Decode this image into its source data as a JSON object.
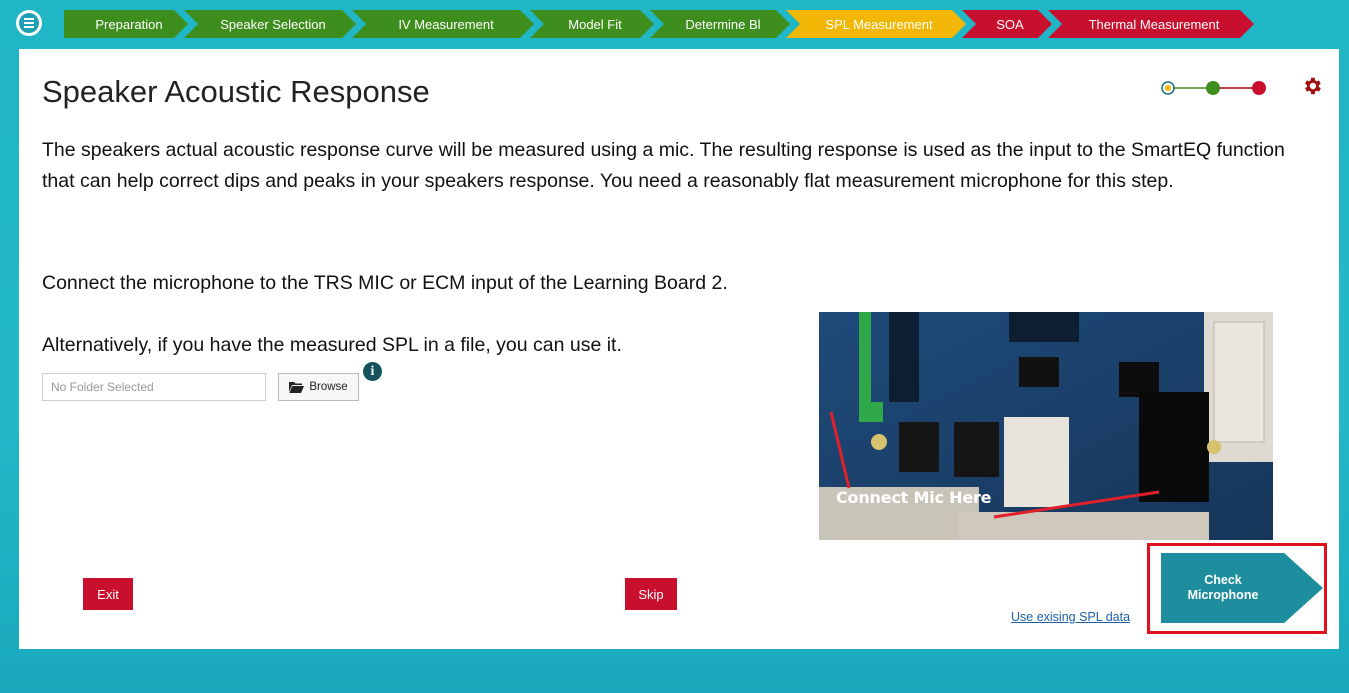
{
  "nav": {
    "steps": [
      {
        "label": "Preparation",
        "color": "#3e8e1e"
      },
      {
        "label": "Speaker Selection",
        "color": "#3e8e1e"
      },
      {
        "label": "IV Measurement",
        "color": "#3e8e1e"
      },
      {
        "label": "Model Fit",
        "color": "#3e8e1e"
      },
      {
        "label": "Determine Bl",
        "color": "#3e8e1e"
      },
      {
        "label": "SPL Measurement",
        "color": "#f2b705"
      },
      {
        "label": "SOA",
        "color": "#c8102e"
      },
      {
        "label": "Thermal Measurement",
        "color": "#c8102e"
      }
    ],
    "menu_icon": "list-menu-icon"
  },
  "page": {
    "title": "Speaker Acoustic Response",
    "paragraph1": "The speakers actual acoustic response curve will be measured using a mic. The resulting response is used as the input to the SmartEQ function that can help correct dips and peaks in your speakers response. You need a reasonably flat measurement microphone for this step.",
    "paragraph2": "Connect the microphone to the TRS MIC or ECM input of the Learning Board 2.",
    "paragraph3": "Alternatively, if you have the measured SPL in a file, you can use it."
  },
  "file_picker": {
    "placeholder": "No Folder Selected",
    "browse_label": "Browse",
    "info_glyph": "i"
  },
  "photo": {
    "caption": "Connect Mic Here"
  },
  "actions": {
    "exit_label": "Exit",
    "skip_label": "Skip",
    "spl_link_label": "Use exising SPL data",
    "check_label_line1": "Check",
    "check_label_line2": "Microphone"
  },
  "progress_dots": [
    {
      "color": "#f2b705",
      "state": "current"
    },
    {
      "color": "#3e8e1e",
      "state": "done"
    },
    {
      "color": "#c8102e",
      "state": "pending"
    }
  ],
  "colors": {
    "accent": "#1e8e9e",
    "danger": "#c8102e",
    "background": "#1fb6c6"
  }
}
